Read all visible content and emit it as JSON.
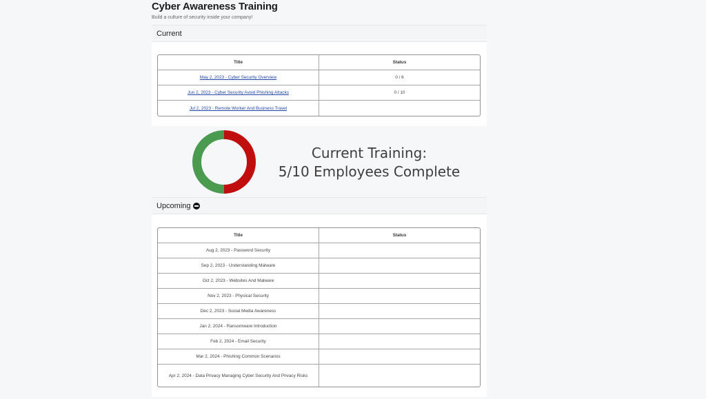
{
  "header": {
    "title": "Cyber Awareness Training",
    "subtitle": "Build a culture of security inside your company!"
  },
  "current": {
    "heading": "Current",
    "columns": [
      "Title",
      "Status"
    ],
    "rows": [
      {
        "title": "May 2, 2023 - Cyber Security Overview",
        "status": "0 / 6"
      },
      {
        "title": "Jun 2, 2023 - Cyber Security Avoid Phishing Attacks",
        "status": "0 / 10"
      },
      {
        "title": "Jul 2, 2023 - Remote Worker And Business Travel",
        "status": ""
      }
    ]
  },
  "progress": {
    "line1": "Current Training:",
    "line2": "5/10 Employees Complete",
    "complete_fraction": 0.5,
    "colors": {
      "complete": "#4a9a4f",
      "incomplete": "#c00d0d"
    }
  },
  "upcoming": {
    "heading": "Upcoming",
    "toggle_icon": "minus-circle-icon",
    "columns": [
      "Title",
      "Status"
    ],
    "rows": [
      {
        "title": "Aug 2, 2023 - Password Security",
        "status": ""
      },
      {
        "title": "Sep 2, 2023 - Understanding Malware",
        "status": ""
      },
      {
        "title": "Oct 2, 2023 - Websites And Malware",
        "status": ""
      },
      {
        "title": "Nov 2, 2023 - Physical Security",
        "status": ""
      },
      {
        "title": "Dec 2, 2023 - Social Media Awareness",
        "status": ""
      },
      {
        "title": "Jan 2, 2024 - Ransomware Introduction",
        "status": ""
      },
      {
        "title": "Feb 2, 2024 - Email Security",
        "status": ""
      },
      {
        "title": "Mar 2, 2024 - Phishing Common Scenarios",
        "status": ""
      },
      {
        "title": "Apr 2, 2024 - Data Privacy Managing Cyber Security And Privacy Risks",
        "status": ""
      }
    ]
  }
}
